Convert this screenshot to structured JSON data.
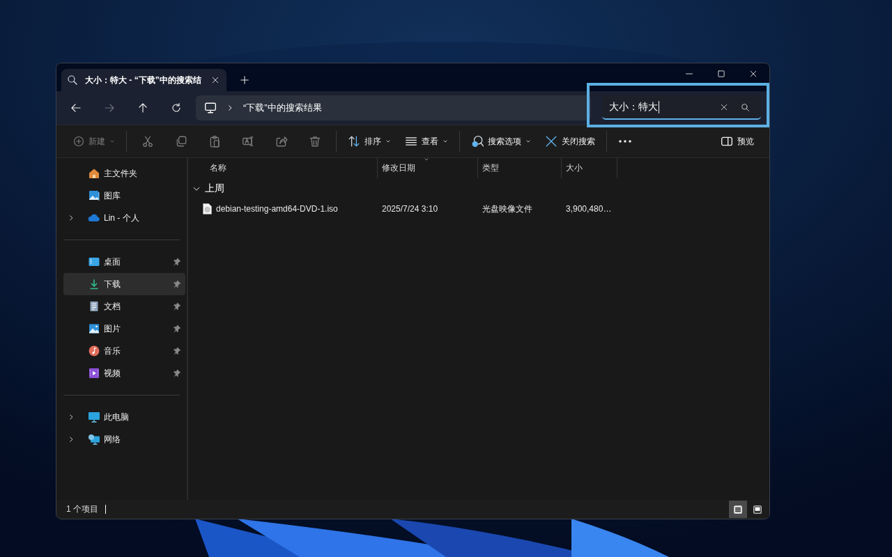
{
  "tab": {
    "title": "大小：特大 - “下载”中的搜索结",
    "selected": true
  },
  "navigation": [
    {
      "disabled": false
    },
    {
      "disabled": true
    },
    {
      "disabled": false
    },
    {
      "disabled": false
    }
  ],
  "address": {
    "path": "“下载”中的搜索结果"
  },
  "search": {
    "value": "大小：特大",
    "highlighted": true
  },
  "toolbar": [
    {
      "kind": "button",
      "label": "新建",
      "dropdown": true,
      "disabled": true
    },
    {
      "kind": "separator"
    },
    {
      "kind": "icon",
      "disabled": true
    },
    {
      "kind": "icon",
      "disabled": true
    },
    {
      "kind": "icon",
      "disabled": true
    },
    {
      "kind": "icon",
      "disabled": true
    },
    {
      "kind": "icon",
      "disabled": true
    },
    {
      "kind": "icon",
      "disabled": true
    },
    {
      "kind": "separator"
    },
    {
      "kind": "button",
      "label": "排序",
      "dropdown": true,
      "disabled": false
    },
    {
      "kind": "button",
      "label": "查看",
      "dropdown": true,
      "disabled": false
    },
    {
      "kind": "separator"
    },
    {
      "kind": "button",
      "label": "搜索选项",
      "dropdown": true,
      "disabled": false
    },
    {
      "kind": "button",
      "label": "关闭搜索",
      "dropdown": false,
      "disabled": false
    },
    {
      "kind": "separator"
    },
    {
      "kind": "icon"
    }
  ],
  "preview": {
    "label": "预览"
  },
  "sidebar": [
    [
      {
        "label": "主文件夹",
        "expandable": false,
        "pinned": false,
        "selected": false
      },
      {
        "label": "图库",
        "expandable": false,
        "pinned": false,
        "selected": false
      },
      {
        "label": "Lin - 个人",
        "expandable": true,
        "pinned": false,
        "selected": false
      }
    ],
    [
      {
        "label": "桌面",
        "expandable": false,
        "pinned": true,
        "selected": false
      },
      {
        "label": "下载",
        "expandable": false,
        "pinned": true,
        "selected": true
      },
      {
        "label": "文档",
        "expandable": false,
        "pinned": true,
        "selected": false
      },
      {
        "label": "图片",
        "expandable": false,
        "pinned": true,
        "selected": false
      },
      {
        "label": "音乐",
        "expandable": false,
        "pinned": true,
        "selected": false
      },
      {
        "label": "视频",
        "expandable": false,
        "pinned": true,
        "selected": false
      }
    ],
    [
      {
        "label": "此电脑",
        "expandable": true,
        "pinned": false,
        "selected": false
      },
      {
        "label": "网络",
        "expandable": true,
        "pinned": false,
        "selected": false
      }
    ]
  ],
  "columns": [
    {
      "label": "名称",
      "sorted": false
    },
    {
      "label": "修改日期",
      "sorted": true
    },
    {
      "label": "类型",
      "sorted": false
    },
    {
      "label": "大小",
      "sorted": false
    }
  ],
  "groups": [
    {
      "label": "上周",
      "expanded": true,
      "rows": [
        {
          "name": "debian-testing-amd64-DVD-1.iso",
          "date": "2025/7/24 3:10",
          "type": "光盘映像文件",
          "size": "3,900,480…"
        }
      ]
    }
  ],
  "status": {
    "text": "1 个项目"
  },
  "views": [
    {
      "selected": true
    },
    {
      "selected": false
    }
  ]
}
